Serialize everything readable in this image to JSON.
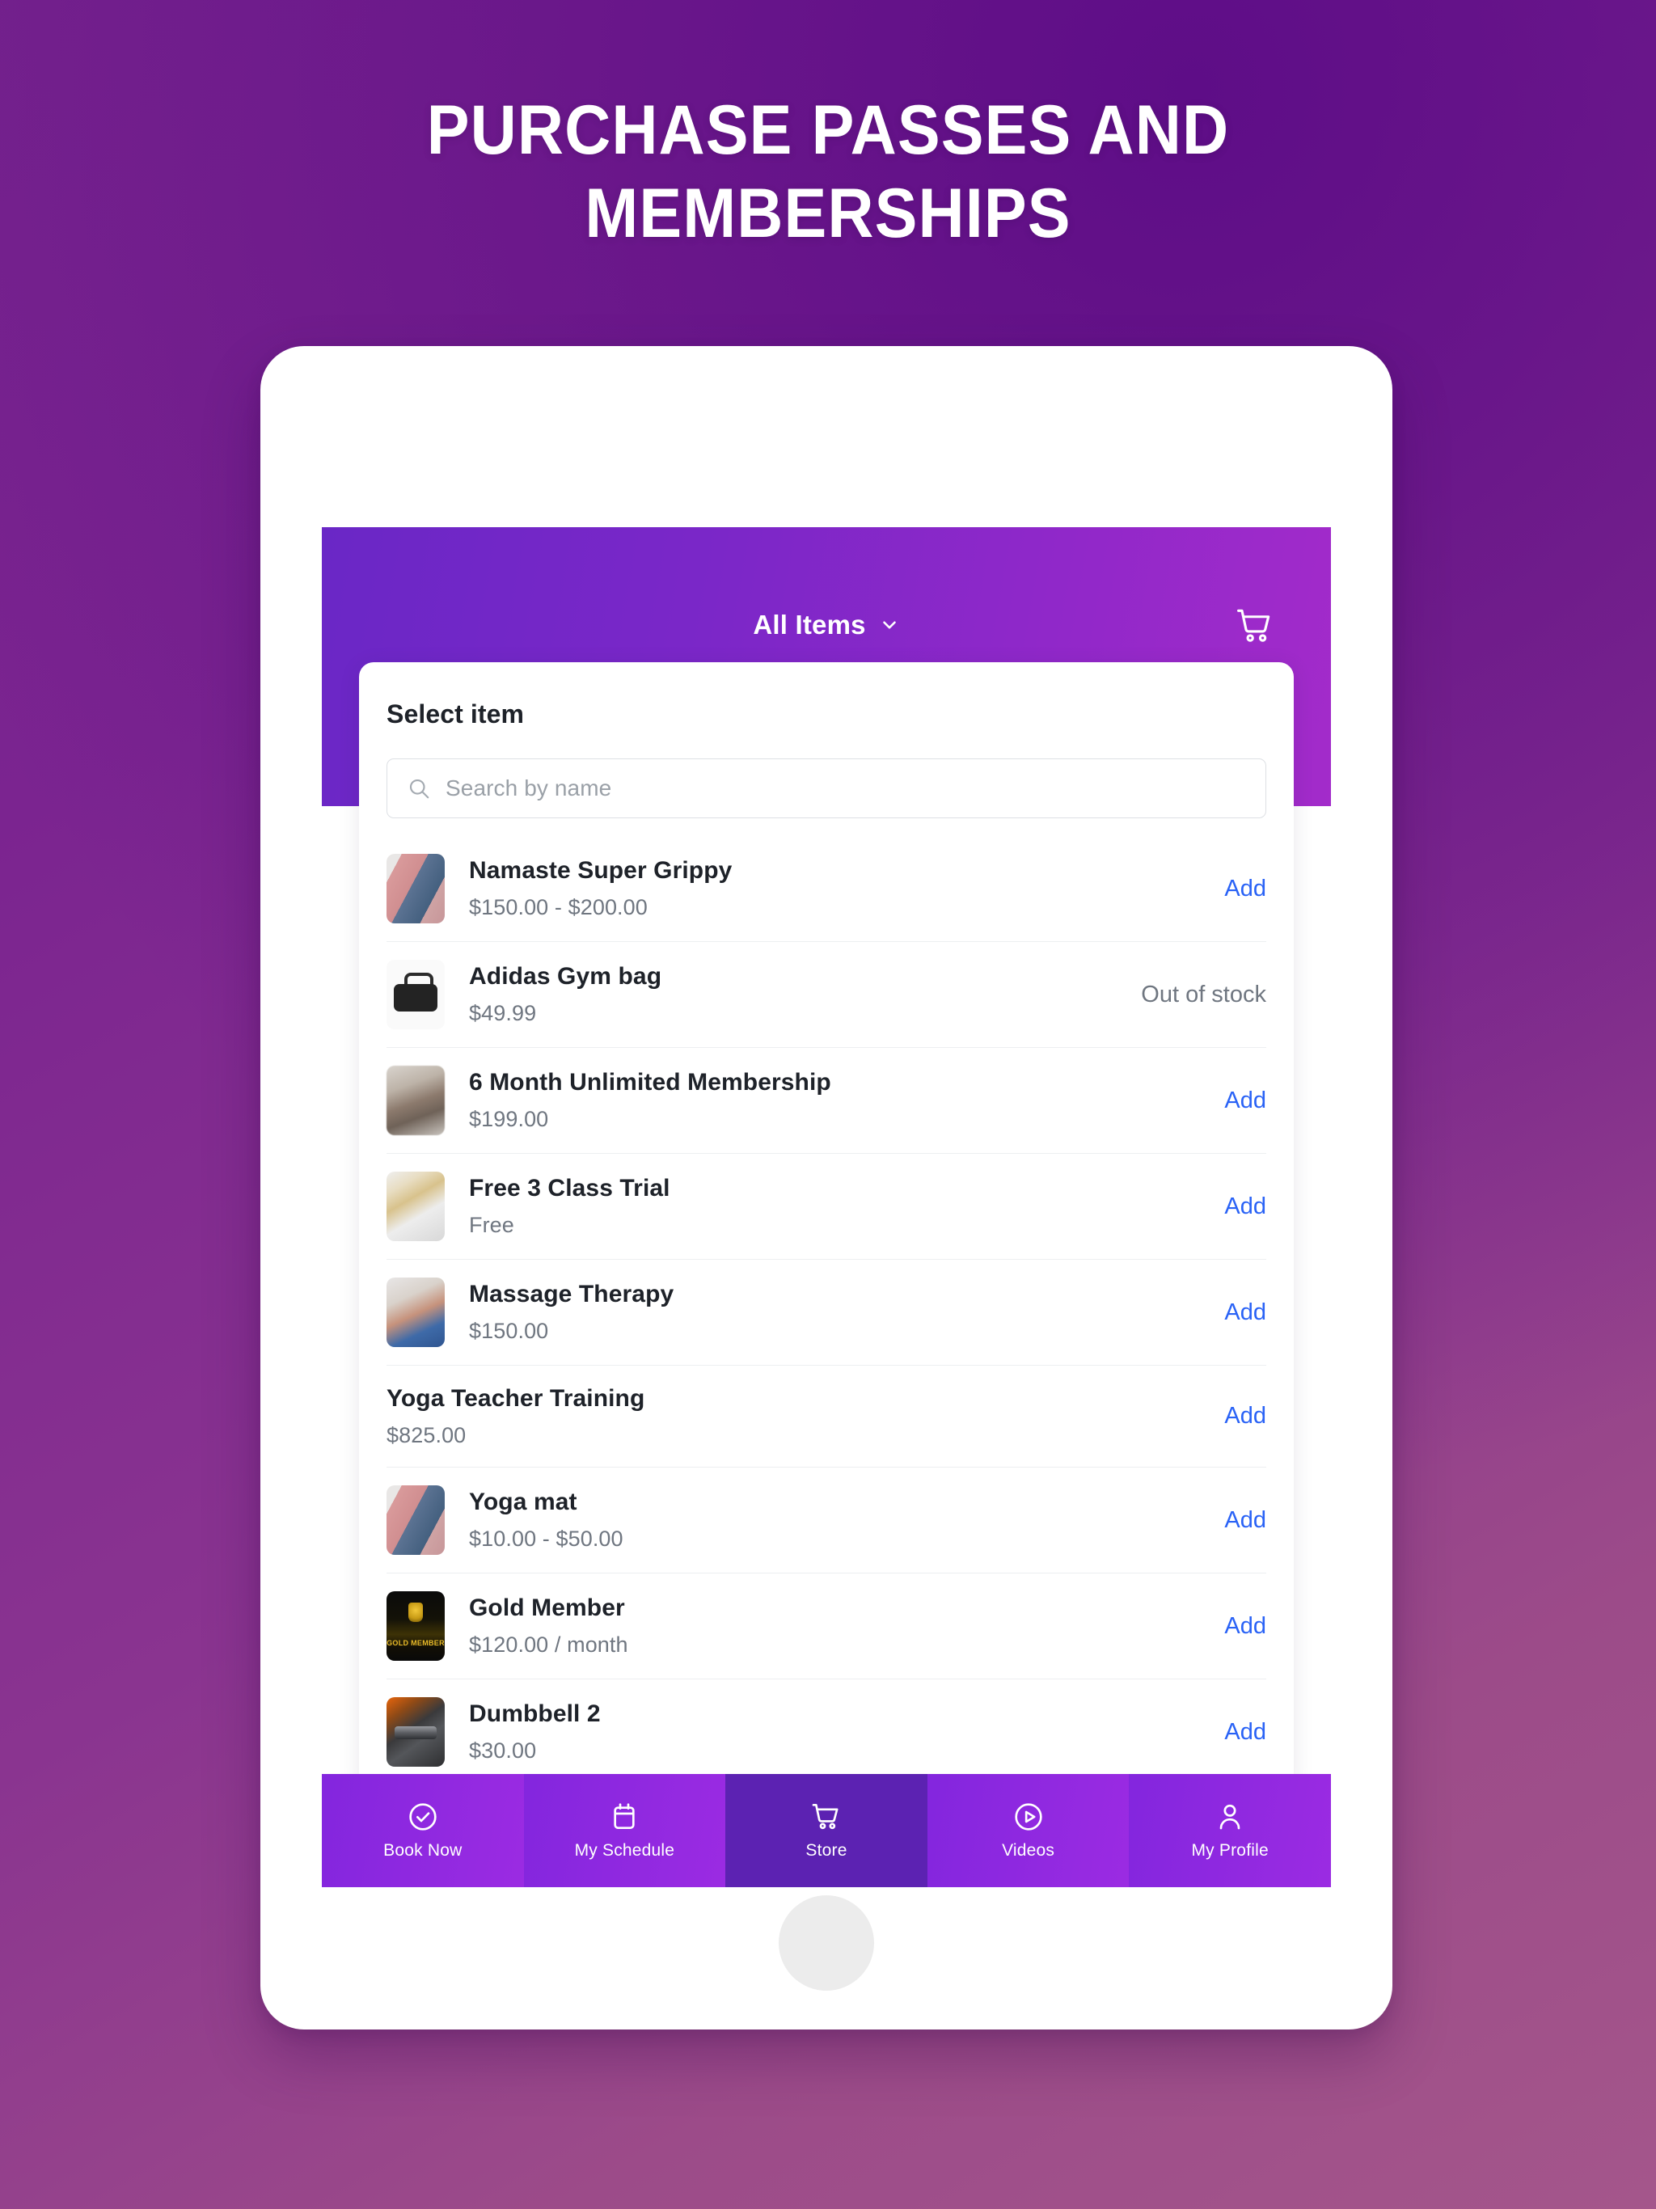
{
  "headline": "Purchase Passes and Memberships",
  "app": {
    "header": {
      "filter_label": "All Items",
      "chevron_icon": "chevron-down-icon",
      "cart_icon": "shopping-cart-icon"
    },
    "panel": {
      "title": "Select item",
      "search": {
        "placeholder": "Search by name",
        "value": "",
        "icon": "search-icon"
      }
    },
    "items": [
      {
        "name": "Namaste Super Grippy",
        "price": "$150.00 - $200.00",
        "action": "Add",
        "action_type": "add",
        "thumb": "img-yogamat",
        "has_thumb": true
      },
      {
        "name": "Adidas Gym bag",
        "price": "$49.99",
        "action": "Out of stock",
        "action_type": "oos",
        "thumb": "img-gymbag",
        "has_thumb": true
      },
      {
        "name": "6 Month Unlimited Membership",
        "price": "$199.00",
        "action": "Add",
        "action_type": "add",
        "thumb": "img-gymclass",
        "has_thumb": true
      },
      {
        "name": "Free 3 Class Trial",
        "price": "Free",
        "action": "Add",
        "action_type": "add",
        "thumb": "img-trial",
        "has_thumb": true
      },
      {
        "name": "Massage Therapy",
        "price": "$150.00",
        "action": "Add",
        "action_type": "add",
        "thumb": "img-massage",
        "has_thumb": true
      },
      {
        "name": "Yoga Teacher Training",
        "price": "$825.00",
        "action": "Add",
        "action_type": "add",
        "thumb": "",
        "has_thumb": false
      },
      {
        "name": "Yoga mat",
        "price": "$10.00 - $50.00",
        "action": "Add",
        "action_type": "add",
        "thumb": "img-yogamat",
        "has_thumb": true
      },
      {
        "name": "Gold Member",
        "price": "$120.00 / month",
        "action": "Add",
        "action_type": "add",
        "thumb": "img-gold",
        "has_thumb": true
      },
      {
        "name": "Dumbbell 2",
        "price": "$30.00",
        "action": "Add",
        "action_type": "add",
        "thumb": "img-dumbbell",
        "has_thumb": true
      }
    ],
    "bottom_nav": [
      {
        "label": "Book Now",
        "icon": "check-circle-icon",
        "active": false
      },
      {
        "label": "My Schedule",
        "icon": "calendar-icon",
        "active": false
      },
      {
        "label": "Store",
        "icon": "shopping-cart-icon",
        "active": true
      },
      {
        "label": "Videos",
        "icon": "play-circle-icon",
        "active": false
      },
      {
        "label": "My Profile",
        "icon": "person-icon",
        "active": false
      }
    ]
  },
  "colors": {
    "background_start": "#75228D",
    "background_end": "#A4568B",
    "app_header_start": "#6A27C6",
    "app_header_end": "#A32BCA",
    "nav_inactive": "#8B2AE0",
    "nav_active": "#5C22B2",
    "add_link": "#2962F6",
    "muted_text": "#6F7680",
    "title_text": "#1E2229"
  }
}
